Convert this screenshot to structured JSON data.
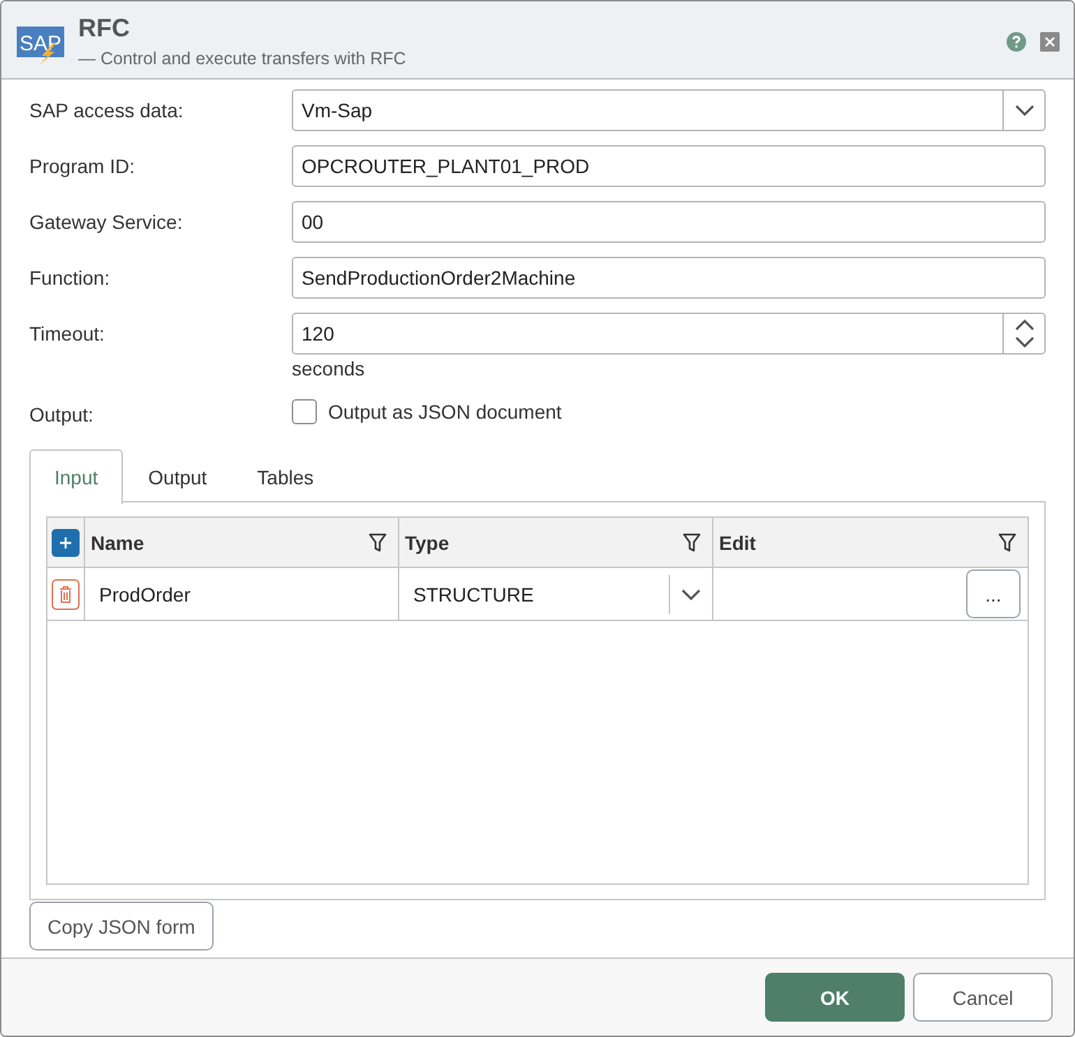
{
  "window": {
    "logo_text": "SAP",
    "title": "RFC",
    "subtitle": "— Control and execute transfers with RFC"
  },
  "form": [
    {
      "kind": "select",
      "label": "SAP access data:",
      "value": "Vm-Sap"
    },
    {
      "kind": "text",
      "label": "Program ID:",
      "value": "OPCROUTER_PLANT01_PROD"
    },
    {
      "kind": "text",
      "label": "Gateway Service:",
      "value": "00"
    },
    {
      "kind": "text",
      "label": "Function:",
      "value": "SendProductionOrder2Machine"
    },
    {
      "kind": "spin",
      "label": "Timeout:",
      "value": "120",
      "unit": "seconds"
    },
    {
      "kind": "checkbox",
      "label": "Output:",
      "text": "Output as JSON document",
      "checked": false
    }
  ],
  "tabs": [
    {
      "label": "Input",
      "selected": true
    },
    {
      "label": "Output",
      "selected": false
    },
    {
      "label": "Tables",
      "selected": false
    }
  ],
  "grid": {
    "columns": [
      {
        "title": "Name"
      },
      {
        "title": "Type"
      },
      {
        "title": "Edit"
      }
    ],
    "rows": [
      {
        "name": "ProdOrder",
        "type": "STRUCTURE",
        "edit_button": "..."
      }
    ]
  },
  "copy_button": "Copy JSON form",
  "buttons": [
    {
      "label": "OK",
      "kind": "primary"
    },
    {
      "label": "Cancel",
      "kind": "secondary"
    }
  ]
}
